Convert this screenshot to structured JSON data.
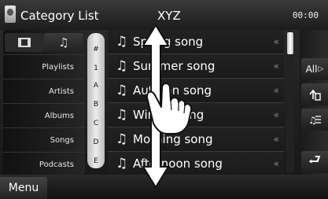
{
  "header": {
    "title": "Category List",
    "source": "XYZ",
    "clock": "00:00"
  },
  "mode_tabs": [
    {
      "icon": "film-icon"
    },
    {
      "icon": "music-note-icon"
    }
  ],
  "categories": [
    {
      "label": "Playlists"
    },
    {
      "label": "Artists"
    },
    {
      "label": "Albums"
    },
    {
      "label": "Songs"
    },
    {
      "label": "Podcasts"
    }
  ],
  "alpha_index": [
    "#",
    "1",
    "A",
    "B",
    "C",
    "D",
    "E"
  ],
  "songs": [
    {
      "title": "Spring song"
    },
    {
      "title": "Summer song"
    },
    {
      "title": "Autumn song"
    },
    {
      "title": "Winter song"
    },
    {
      "title": "Morning song"
    },
    {
      "title": "Afternoon song"
    }
  ],
  "side_buttons": {
    "all_label": "All",
    "all_arrow": "▷",
    "up_icon": "folder-up-icon",
    "list_icon": "list-icon",
    "return_glyph": "⮐"
  },
  "footer": {
    "menu_label": "Menu"
  },
  "gesture": {
    "type": "vertical-flick",
    "icon": "hand-pointer-icon"
  },
  "colors": {
    "background": "#1a1a1a",
    "text": "#ffffff",
    "alpha_bar": "#e0e0e0"
  }
}
